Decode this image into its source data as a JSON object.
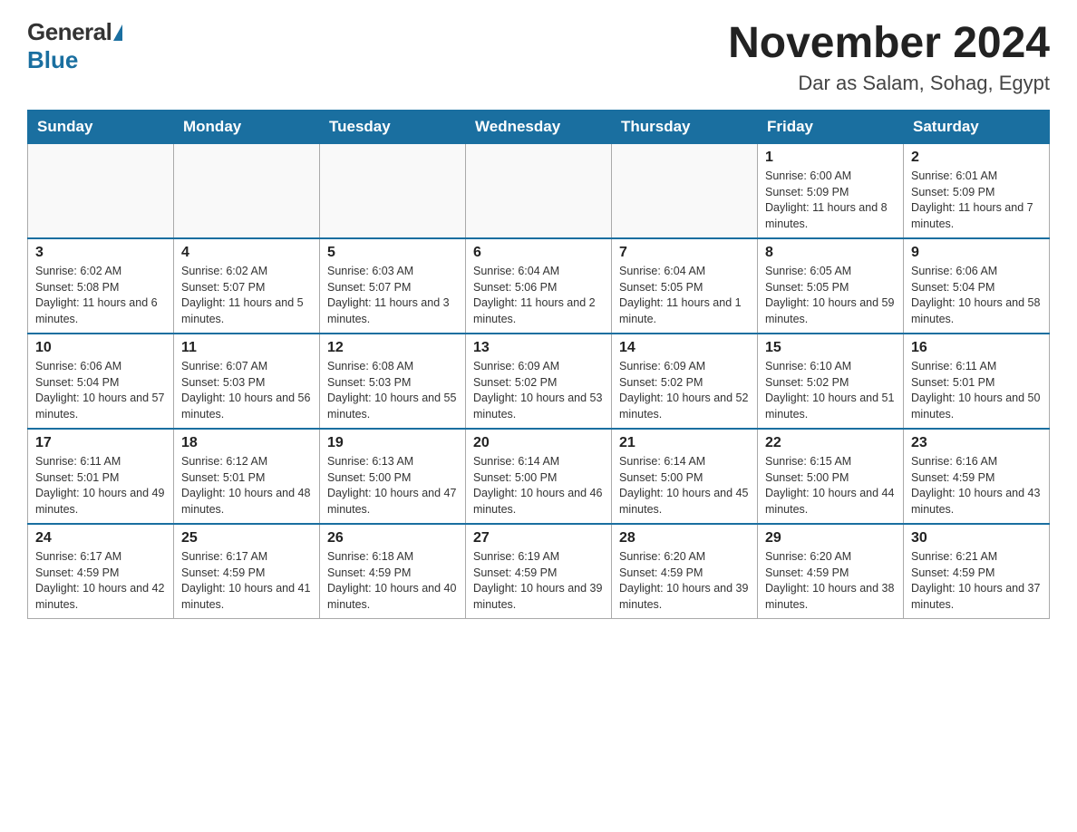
{
  "header": {
    "logo_general": "General",
    "logo_blue": "Blue",
    "month_year": "November 2024",
    "location": "Dar as Salam, Sohag, Egypt"
  },
  "days_of_week": [
    "Sunday",
    "Monday",
    "Tuesday",
    "Wednesday",
    "Thursday",
    "Friday",
    "Saturday"
  ],
  "weeks": [
    [
      {
        "day": "",
        "info": ""
      },
      {
        "day": "",
        "info": ""
      },
      {
        "day": "",
        "info": ""
      },
      {
        "day": "",
        "info": ""
      },
      {
        "day": "",
        "info": ""
      },
      {
        "day": "1",
        "info": "Sunrise: 6:00 AM\nSunset: 5:09 PM\nDaylight: 11 hours and 8 minutes."
      },
      {
        "day": "2",
        "info": "Sunrise: 6:01 AM\nSunset: 5:09 PM\nDaylight: 11 hours and 7 minutes."
      }
    ],
    [
      {
        "day": "3",
        "info": "Sunrise: 6:02 AM\nSunset: 5:08 PM\nDaylight: 11 hours and 6 minutes."
      },
      {
        "day": "4",
        "info": "Sunrise: 6:02 AM\nSunset: 5:07 PM\nDaylight: 11 hours and 5 minutes."
      },
      {
        "day": "5",
        "info": "Sunrise: 6:03 AM\nSunset: 5:07 PM\nDaylight: 11 hours and 3 minutes."
      },
      {
        "day": "6",
        "info": "Sunrise: 6:04 AM\nSunset: 5:06 PM\nDaylight: 11 hours and 2 minutes."
      },
      {
        "day": "7",
        "info": "Sunrise: 6:04 AM\nSunset: 5:05 PM\nDaylight: 11 hours and 1 minute."
      },
      {
        "day": "8",
        "info": "Sunrise: 6:05 AM\nSunset: 5:05 PM\nDaylight: 10 hours and 59 minutes."
      },
      {
        "day": "9",
        "info": "Sunrise: 6:06 AM\nSunset: 5:04 PM\nDaylight: 10 hours and 58 minutes."
      }
    ],
    [
      {
        "day": "10",
        "info": "Sunrise: 6:06 AM\nSunset: 5:04 PM\nDaylight: 10 hours and 57 minutes."
      },
      {
        "day": "11",
        "info": "Sunrise: 6:07 AM\nSunset: 5:03 PM\nDaylight: 10 hours and 56 minutes."
      },
      {
        "day": "12",
        "info": "Sunrise: 6:08 AM\nSunset: 5:03 PM\nDaylight: 10 hours and 55 minutes."
      },
      {
        "day": "13",
        "info": "Sunrise: 6:09 AM\nSunset: 5:02 PM\nDaylight: 10 hours and 53 minutes."
      },
      {
        "day": "14",
        "info": "Sunrise: 6:09 AM\nSunset: 5:02 PM\nDaylight: 10 hours and 52 minutes."
      },
      {
        "day": "15",
        "info": "Sunrise: 6:10 AM\nSunset: 5:02 PM\nDaylight: 10 hours and 51 minutes."
      },
      {
        "day": "16",
        "info": "Sunrise: 6:11 AM\nSunset: 5:01 PM\nDaylight: 10 hours and 50 minutes."
      }
    ],
    [
      {
        "day": "17",
        "info": "Sunrise: 6:11 AM\nSunset: 5:01 PM\nDaylight: 10 hours and 49 minutes."
      },
      {
        "day": "18",
        "info": "Sunrise: 6:12 AM\nSunset: 5:01 PM\nDaylight: 10 hours and 48 minutes."
      },
      {
        "day": "19",
        "info": "Sunrise: 6:13 AM\nSunset: 5:00 PM\nDaylight: 10 hours and 47 minutes."
      },
      {
        "day": "20",
        "info": "Sunrise: 6:14 AM\nSunset: 5:00 PM\nDaylight: 10 hours and 46 minutes."
      },
      {
        "day": "21",
        "info": "Sunrise: 6:14 AM\nSunset: 5:00 PM\nDaylight: 10 hours and 45 minutes."
      },
      {
        "day": "22",
        "info": "Sunrise: 6:15 AM\nSunset: 5:00 PM\nDaylight: 10 hours and 44 minutes."
      },
      {
        "day": "23",
        "info": "Sunrise: 6:16 AM\nSunset: 4:59 PM\nDaylight: 10 hours and 43 minutes."
      }
    ],
    [
      {
        "day": "24",
        "info": "Sunrise: 6:17 AM\nSunset: 4:59 PM\nDaylight: 10 hours and 42 minutes."
      },
      {
        "day": "25",
        "info": "Sunrise: 6:17 AM\nSunset: 4:59 PM\nDaylight: 10 hours and 41 minutes."
      },
      {
        "day": "26",
        "info": "Sunrise: 6:18 AM\nSunset: 4:59 PM\nDaylight: 10 hours and 40 minutes."
      },
      {
        "day": "27",
        "info": "Sunrise: 6:19 AM\nSunset: 4:59 PM\nDaylight: 10 hours and 39 minutes."
      },
      {
        "day": "28",
        "info": "Sunrise: 6:20 AM\nSunset: 4:59 PM\nDaylight: 10 hours and 39 minutes."
      },
      {
        "day": "29",
        "info": "Sunrise: 6:20 AM\nSunset: 4:59 PM\nDaylight: 10 hours and 38 minutes."
      },
      {
        "day": "30",
        "info": "Sunrise: 6:21 AM\nSunset: 4:59 PM\nDaylight: 10 hours and 37 minutes."
      }
    ]
  ]
}
